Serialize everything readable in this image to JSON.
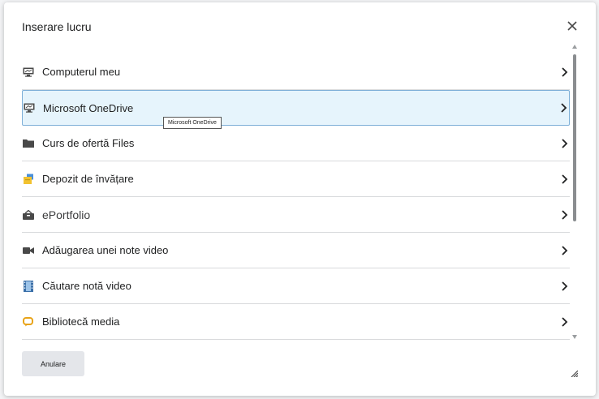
{
  "dialog": {
    "title": "Inserare lucru",
    "close_icon": "close-icon",
    "cancel_label": "Anulare",
    "tooltip": "Microsoft OneDrive"
  },
  "items": [
    {
      "label": "Computerul meu",
      "icon": "computer-icon"
    },
    {
      "label": "Microsoft OneDrive",
      "icon": "computer-icon"
    },
    {
      "label": "Curs de ofertă Files",
      "icon": "folder-icon"
    },
    {
      "label": "Depozit de învățare",
      "icon": "repository-icon"
    },
    {
      "label": "ePortfolio",
      "icon": "briefcase-icon"
    },
    {
      "label": "Adăugarea unei note video",
      "icon": "video-camera-icon"
    },
    {
      "label": "Căutare notă video",
      "icon": "film-icon"
    },
    {
      "label": "Bibliotecă media",
      "icon": "media-icon"
    }
  ],
  "colors": {
    "selected_bg": "#e6f4fc",
    "selected_border": "#7fb0d8",
    "repository_blue": "#4a8fd8",
    "repository_yellow": "#f2c230",
    "media_orange": "#e8a317"
  }
}
